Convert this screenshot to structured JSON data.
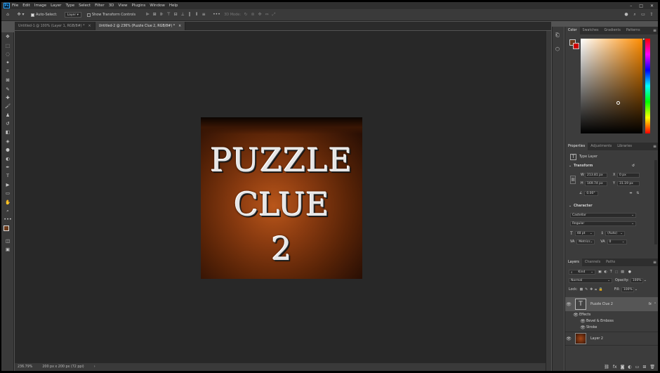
{
  "app": {
    "icon": "Ps"
  },
  "menu": [
    "File",
    "Edit",
    "Image",
    "Layer",
    "Type",
    "Select",
    "Filter",
    "3D",
    "View",
    "Plugins",
    "Window",
    "Help"
  ],
  "options": {
    "auto_select_label": "Auto-Select:",
    "auto_select_value": "Layer",
    "transform_controls_label": "Show Transform Controls",
    "mode_3d_label": "3D Mode:"
  },
  "tabs": [
    {
      "label": "Untitled-1 @ 100% (Layer 1, RGB/8#) *",
      "close": "×"
    },
    {
      "label": "Untitled-2 @ 236% (Puzzle Clue 2, RGB/8#) *",
      "close": "×"
    }
  ],
  "document": {
    "line1": "PUZZLE",
    "line2": "CLUE",
    "line3": "2"
  },
  "status": {
    "zoom": "236.79%",
    "size": "200 px x 200 px (72 ppi)",
    "arrow": "›"
  },
  "color_panel": {
    "tabs": [
      "Color",
      "Swatches",
      "Gradients",
      "Patterns"
    ],
    "hue": "#ff8c00",
    "fg": "#6b3a1a",
    "bg": "#cc0000"
  },
  "properties": {
    "tabs": [
      "Properties",
      "Adjustments",
      "Libraries"
    ],
    "kind": "Type Layer",
    "transform_heading": "Transform",
    "w_label": "W",
    "w": "213.81 px",
    "h_label": "H",
    "h": "169.74 px",
    "x_label": "X",
    "x": "0 px",
    "y_label": "Y",
    "y": "31.19 px",
    "angle": "0.00°",
    "character_heading": "Character",
    "font": "Castellar",
    "style": "Regular",
    "size": "48 pt",
    "leading": "(Auto)",
    "kerning": "Metrics",
    "tracking": "0"
  },
  "layers_panel": {
    "tabs": [
      "Layers",
      "Channels",
      "Paths"
    ],
    "kind": "Kind",
    "blend": "Normal",
    "opacity_label": "Opacity:",
    "opacity": "100%",
    "lock_label": "Lock:",
    "fill_label": "Fill:",
    "fill": "100%",
    "layers": [
      {
        "name": "Puzzle Clue 2",
        "fx": "fx"
      },
      {
        "effects": "Effects"
      },
      {
        "effect": "Bevel & Emboss"
      },
      {
        "effect": "Stroke"
      },
      {
        "name": "Layer 2"
      }
    ]
  }
}
